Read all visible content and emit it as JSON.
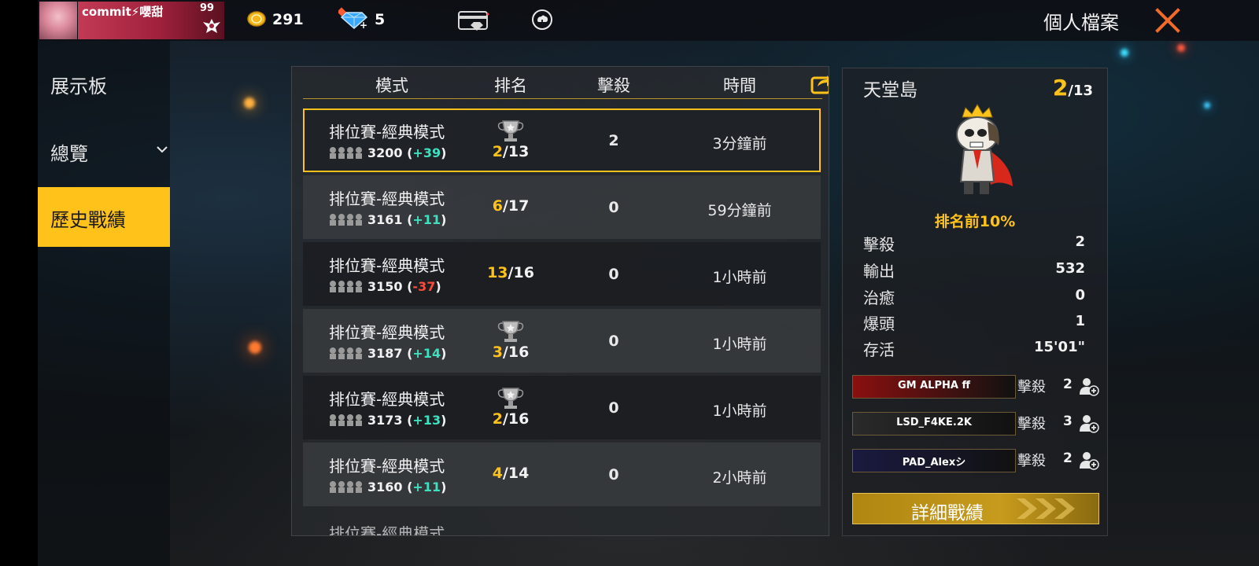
{
  "player": {
    "name": "commit⚡嚶甜",
    "level": "99"
  },
  "currency": {
    "coins": "291",
    "diamonds": "5"
  },
  "page_title": "個人檔案",
  "sidebar": {
    "items": [
      {
        "label": "展示板",
        "active": false
      },
      {
        "label": "總覽",
        "active": false
      },
      {
        "label": "歷史戰績",
        "active": true
      }
    ]
  },
  "table": {
    "headers": [
      "模式",
      "排名",
      "擊殺",
      "時間"
    ],
    "rows": [
      {
        "mode": "排位賽-經典模式",
        "score": "3200",
        "delta": "+39",
        "rank": "2",
        "total": "/13",
        "kills": "2",
        "time": "3分鐘前",
        "selected": true
      },
      {
        "mode": "排位賽-經典模式",
        "score": "3161",
        "delta": "+11",
        "rank": "6",
        "total": "/17",
        "kills": "0",
        "time": "59分鐘前",
        "selected": false
      },
      {
        "mode": "排位賽-經典模式",
        "score": "3150",
        "delta": "-37",
        "rank": "13",
        "total": "/16",
        "kills": "0",
        "time": "1小時前",
        "selected": false
      },
      {
        "mode": "排位賽-經典模式",
        "score": "3187",
        "delta": "+14",
        "rank": "3",
        "total": "/16",
        "kills": "0",
        "time": "1小時前",
        "selected": false
      },
      {
        "mode": "排位賽-經典模式",
        "score": "3173",
        "delta": "+13",
        "rank": "2",
        "total": "/16",
        "kills": "0",
        "time": "1小時前",
        "selected": false
      },
      {
        "mode": "排位賽-經典模式",
        "score": "3160",
        "delta": "+11",
        "rank": "4",
        "total": "/14",
        "kills": "0",
        "time": "2小時前",
        "selected": false
      }
    ],
    "partial_row_mode": "排位賽-經典模式"
  },
  "detail": {
    "map": "天堂島",
    "rank": "2",
    "rank_total": "/13",
    "top_percent": "排名前10%",
    "stats": [
      {
        "label": "擊殺",
        "value": "2"
      },
      {
        "label": "輸出",
        "value": "532"
      },
      {
        "label": "治癒",
        "value": "0"
      },
      {
        "label": "爆頭",
        "value": "1"
      },
      {
        "label": "存活",
        "value": "15'01\""
      }
    ],
    "teammates": [
      {
        "name": "GM  ALPHA  ff",
        "kill_label": "擊殺",
        "kills": "2",
        "color": "#8a1010"
      },
      {
        "name": "LSD_F4KE.2K",
        "kill_label": "擊殺",
        "kills": "3",
        "color": "#2a2a2a"
      },
      {
        "name": "PAD_Alexシ",
        "kill_label": "擊殺",
        "kills": "2",
        "color": "#1a1a40"
      }
    ],
    "detail_button": "詳細戰績"
  },
  "colors": {
    "accent": "#ffc21a",
    "positive": "#3ee0c0",
    "negative": "#ff4a3a",
    "close": "#f06a2a"
  }
}
